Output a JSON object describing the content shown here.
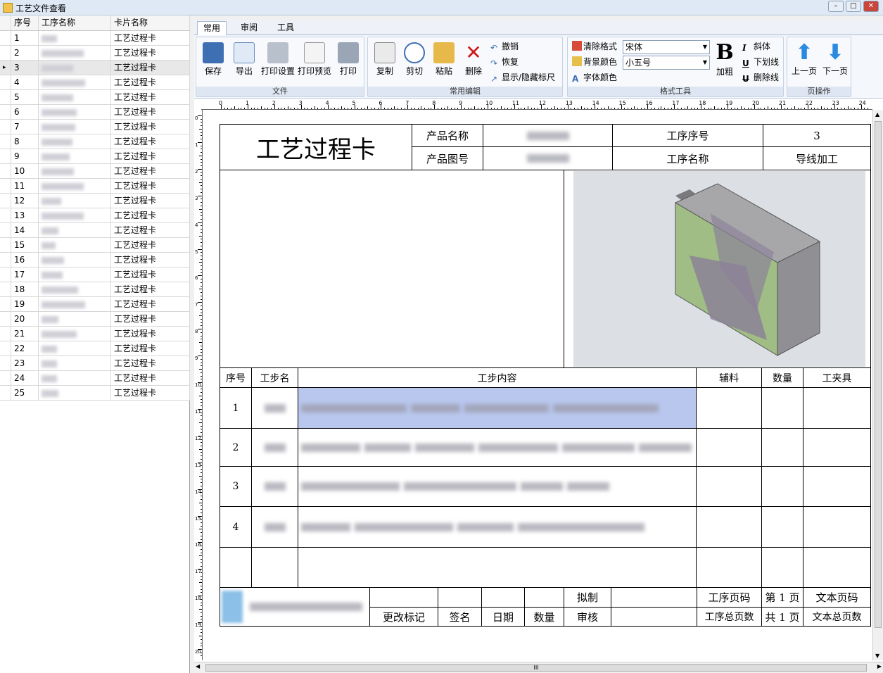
{
  "window": {
    "title": "工艺文件查看"
  },
  "grid": {
    "headers": [
      "序号",
      "工序名称",
      "卡片名称"
    ],
    "rows": [
      {
        "no": "1",
        "card": "工艺过程卡"
      },
      {
        "no": "2",
        "card": "工艺过程卡"
      },
      {
        "no": "3",
        "card": "工艺过程卡"
      },
      {
        "no": "4",
        "card": "工艺过程卡"
      },
      {
        "no": "5",
        "card": "工艺过程卡"
      },
      {
        "no": "6",
        "card": "工艺过程卡"
      },
      {
        "no": "7",
        "card": "工艺过程卡"
      },
      {
        "no": "8",
        "card": "工艺过程卡"
      },
      {
        "no": "9",
        "card": "工艺过程卡"
      },
      {
        "no": "10",
        "card": "工艺过程卡"
      },
      {
        "no": "11",
        "card": "工艺过程卡"
      },
      {
        "no": "12",
        "card": "工艺过程卡"
      },
      {
        "no": "13",
        "card": "工艺过程卡"
      },
      {
        "no": "14",
        "card": "工艺过程卡"
      },
      {
        "no": "15",
        "card": "工艺过程卡"
      },
      {
        "no": "16",
        "card": "工艺过程卡"
      },
      {
        "no": "17",
        "card": "工艺过程卡"
      },
      {
        "no": "18",
        "card": "工艺过程卡"
      },
      {
        "no": "19",
        "card": "工艺过程卡"
      },
      {
        "no": "20",
        "card": "工艺过程卡"
      },
      {
        "no": "21",
        "card": "工艺过程卡"
      },
      {
        "no": "22",
        "card": "工艺过程卡"
      },
      {
        "no": "23",
        "card": "工艺过程卡"
      },
      {
        "no": "24",
        "card": "工艺过程卡"
      },
      {
        "no": "25",
        "card": "工艺过程卡"
      }
    ]
  },
  "tabs": [
    "常用",
    "审阅",
    "工具"
  ],
  "ribbon": {
    "file": {
      "label": "文件",
      "save": "保存",
      "export": "导出",
      "print_setup": "打印设置",
      "print_preview": "打印预览",
      "print": "打印"
    },
    "edit": {
      "label": "常用编辑",
      "copy": "复制",
      "cut": "剪切",
      "paste": "粘贴",
      "delete": "删除",
      "undo": "撤销",
      "redo": "恢复",
      "toggle_ruler": "显示/隐藏标尺"
    },
    "format": {
      "label": "格式工具",
      "clear": "清除格式",
      "bgcolor": "背景颜色",
      "fontcolor": "字体颜色",
      "font": "宋体",
      "size": "小五号",
      "bold": "加粗",
      "italic": "斜体",
      "underline": "下划线",
      "strike": "删除线",
      "bold_glyph": "B",
      "italic_glyph": "I",
      "underline_glyph": "U"
    },
    "page": {
      "label": "页操作",
      "prev": "上一页",
      "next": "下一页"
    }
  },
  "ruler": {
    "numbers": [
      "0",
      "1",
      "2",
      "3",
      "4",
      "5",
      "6",
      "7",
      "8",
      "9",
      "10",
      "11",
      "12",
      "13",
      "14",
      "15",
      "16",
      "17",
      "18",
      "19",
      "20",
      "21",
      "22",
      "23",
      "24"
    ]
  },
  "card": {
    "title": "工艺过程卡",
    "product_name_label": "产品名称",
    "product_drawing_label": "产品图号",
    "op_no_label": "工序序号",
    "op_no_value": "3",
    "op_name_label": "工序名称",
    "op_name_value": "导线加工",
    "steps_header": {
      "no": "序号",
      "name": "工步名",
      "content": "工步内容",
      "aux": "辅料",
      "qty": "数量",
      "tool": "工夹具"
    },
    "steps": [
      "1",
      "2",
      "3",
      "4"
    ],
    "footer": {
      "draft": "拟制",
      "review": "审核",
      "change_mark": "更改标记",
      "sign": "签名",
      "date": "日期",
      "qty": "数量",
      "op_page": "工序页码",
      "op_total": "工序总页数",
      "page_no": "第 1 页",
      "page_total": "共 1 页",
      "text_page": "文本页码",
      "text_total": "文本总页数"
    }
  },
  "scroll": {
    "hthumb": "III"
  }
}
